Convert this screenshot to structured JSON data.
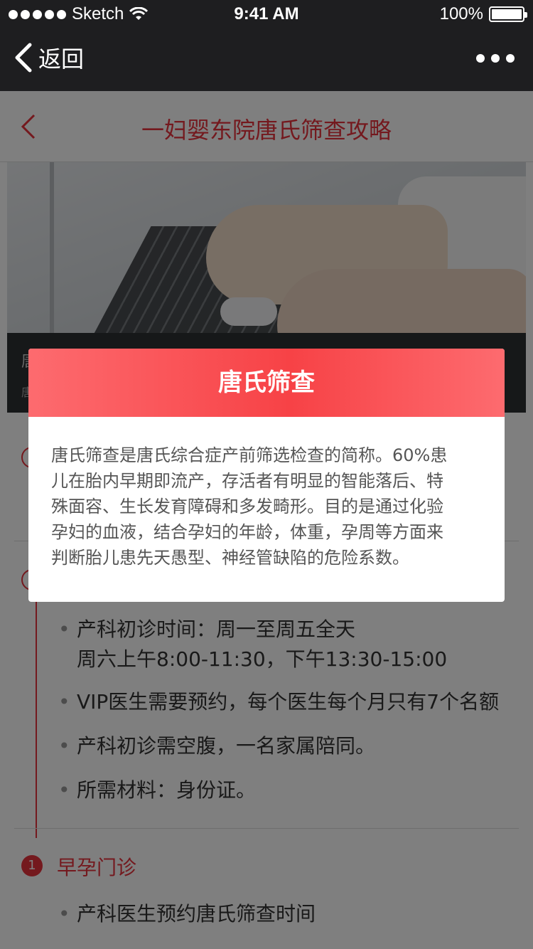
{
  "status_bar": {
    "carrier": "Sketch",
    "time": "9:41 AM",
    "battery": "100%"
  },
  "nav": {
    "back_label": "返回"
  },
  "page": {
    "title": "一妇婴东院唐氏筛查攻略"
  },
  "hero": {
    "caption_title": "唐",
    "caption_sub": "唐"
  },
  "section1": {
    "bullets": [
      "产科初诊时间：周一至周五全天",
      "周六上午8:00-11:30，下午13:30-15:00",
      "VIP医生需要预约，每个医生每个月只有7个名额",
      "产科初诊需空腹，一名家属陪同。",
      "所需材料：身份证。"
    ]
  },
  "section2": {
    "number": "1",
    "title": "早孕门诊",
    "bullets": [
      "产科医生预约唐氏筛查时间"
    ]
  },
  "modal": {
    "title": "唐氏筛查",
    "lines": [
      "唐氏筛查是唐氏综合症产前筛选检查的简称。60%患",
      "儿在胎内早期即流产，存活者有明显的智能落后、特",
      "殊面容、生长发育障碍和多发畸形。目的是通过化验",
      "孕妇的血液，结合孕妇的年龄，体重，孕周等方面来",
      "判断胎儿患先天愚型、神经管缺陷的危险系数。"
    ]
  },
  "colors": {
    "accent": "#e8323d",
    "bar": "#1e1e20"
  }
}
